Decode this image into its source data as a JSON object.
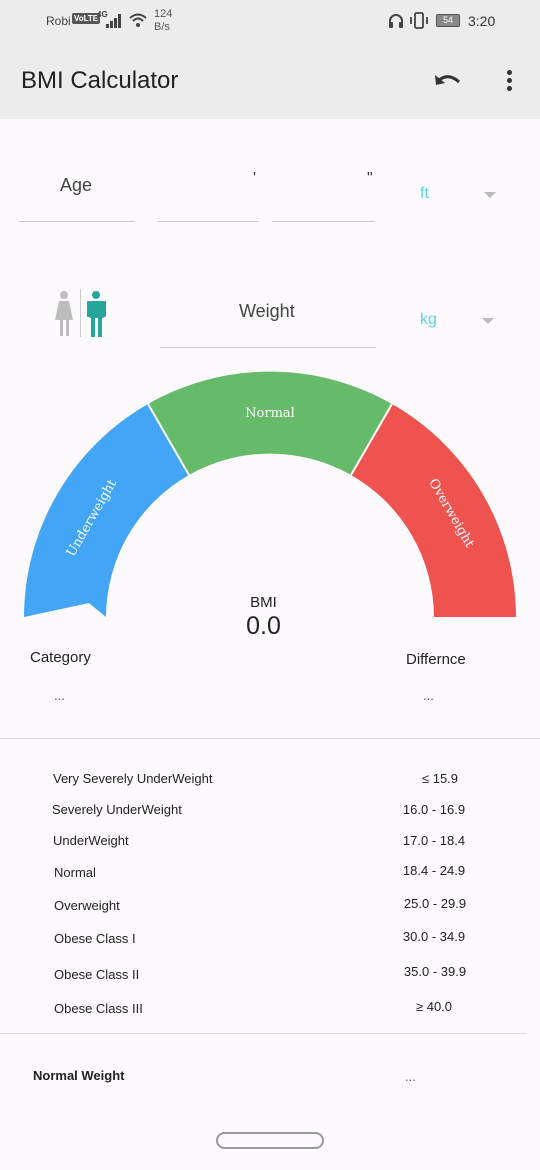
{
  "status_bar": {
    "carrier": "Robi",
    "volte": "VoLTE",
    "network": "4G",
    "speed_value": "124",
    "speed_unit": "B/s",
    "battery": "54",
    "time": "3:20"
  },
  "app_bar": {
    "title": "BMI Calculator",
    "undo_icon": "undo-icon",
    "more_icon": "more-vert-icon"
  },
  "height_row": {
    "age_label": "Age",
    "feet_mark": "'",
    "inch_mark": "\"",
    "unit": "ft"
  },
  "weight_row": {
    "gender_icons": [
      "female-icon",
      "male-icon"
    ],
    "weight_label": "Weight",
    "unit": "kg"
  },
  "gauge": {
    "segments": [
      {
        "label": "Underweight",
        "color": "#42a5f5"
      },
      {
        "label": "Normal",
        "color": "#66bb6a"
      },
      {
        "label": "Overweight",
        "color": "#ef5350"
      }
    ],
    "bmi_label": "BMI",
    "bmi_value": "0.0"
  },
  "result": {
    "category_label": "Category",
    "category_value": "...",
    "difference_label": "Differnce",
    "difference_value": "..."
  },
  "ranges": [
    {
      "name": "Very Severely UnderWeight",
      "value": "≤ 15.9"
    },
    {
      "name": "Severely UnderWeight",
      "value": "16.0 - 16.9"
    },
    {
      "name": "UnderWeight",
      "value": "17.0 - 18.4"
    },
    {
      "name": "Normal",
      "value": "18.4 - 24.9"
    },
    {
      "name": "Overweight",
      "value": "25.0 - 29.9"
    },
    {
      "name": "Obese Class I",
      "value": "30.0 - 34.9"
    },
    {
      "name": "Obese Class II",
      "value": "35.0 - 39.9"
    },
    {
      "name": "Obese Class III",
      "value": "≥ 40.0"
    }
  ],
  "normal_weight": {
    "label": "Normal Weight",
    "value": "..."
  },
  "colors": {
    "accent": "#5fd0e6",
    "male_icon": "#26a69a",
    "female_icon": "#bdbdbd"
  }
}
